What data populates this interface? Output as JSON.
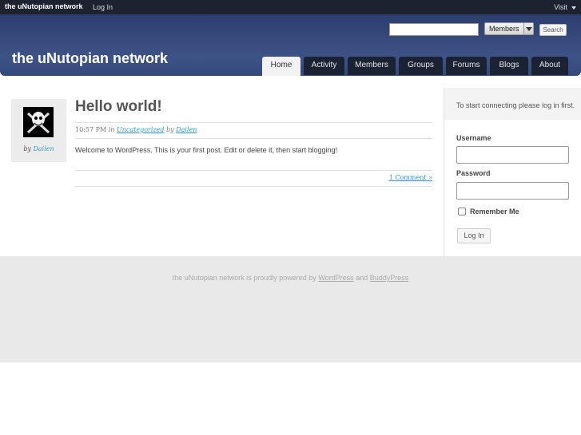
{
  "adminbar": {
    "site_name": "the uNutopian network",
    "login_label": "Log In",
    "visit_label": "Visit"
  },
  "header": {
    "site_title": "the uNutopian network",
    "search": {
      "value": "",
      "scope_selected": "Members",
      "button_label": "Search"
    },
    "nav": [
      "Home",
      "Activity",
      "Members",
      "Groups",
      "Forums",
      "Blogs",
      "About"
    ],
    "active_tab": "Home"
  },
  "post": {
    "title": "Hello world!",
    "time": "10:57 PM",
    "in_word": "in",
    "category": "Uncategorized",
    "by_word": "by",
    "author": "Dailen",
    "body": "Welcome to WordPress. This is your first post. Edit or delete it, then start blogging!",
    "comments_link": "1 Comment »",
    "avatar_by": "by",
    "avatar_author": "Dailen"
  },
  "sidebar": {
    "intro": "To start connecting please log in first.",
    "username_label": "Username",
    "password_label": "Password",
    "remember_label": "Remember Me",
    "login_button": "Log In"
  },
  "footer": {
    "prefix": "the uNutopian network is proudly powered by",
    "link1": "WordPress",
    "and_word": "and",
    "link2": "BuddyPress"
  },
  "colors": {
    "header_bg": "#34497a",
    "adminbar_bg": "#1c2230",
    "tab_bg": "#1b2233",
    "link": "#2a9fd6",
    "footer_bg": "#e9e9e9"
  }
}
